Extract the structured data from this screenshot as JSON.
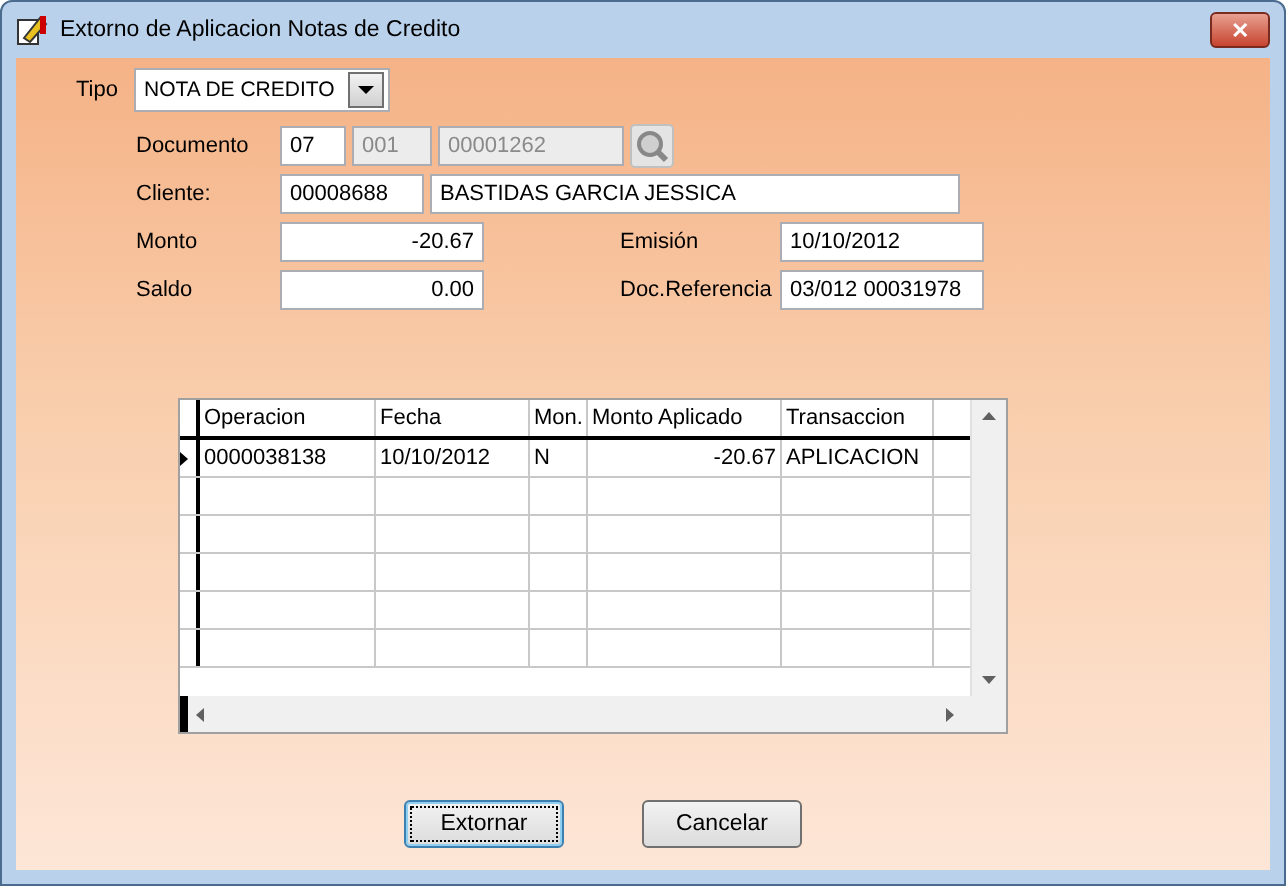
{
  "window": {
    "title": "Extorno de Aplicacion Notas de Credito",
    "close": "✕"
  },
  "tipo": {
    "label": "Tipo",
    "value": "NOTA DE CREDITO"
  },
  "documento": {
    "label": "Documento",
    "fields": [
      {
        "value": "07",
        "disabled": false
      },
      {
        "value": "001",
        "disabled": true
      },
      {
        "value": "00001262",
        "disabled": true
      }
    ]
  },
  "cliente": {
    "label": "Cliente:",
    "code": "00008688",
    "name": "BASTIDAS GARCIA JESSICA"
  },
  "monto": {
    "label": "Monto",
    "value": "-20.67"
  },
  "emision": {
    "label": "Emisión",
    "value": "10/10/2012"
  },
  "saldo": {
    "label": "Saldo",
    "value": "0.00"
  },
  "doc_referencia": {
    "label": "Doc.Referencia",
    "value": "03/012 00031978"
  },
  "table": {
    "columns": [
      "Operacion",
      "Fecha",
      "Mon.",
      "Monto Aplicado",
      "Transaccion"
    ],
    "rows": [
      {
        "selected": true,
        "cells": [
          "0000038138",
          "10/10/2012",
          "N",
          "-20.67",
          "APLICACION"
        ]
      }
    ]
  },
  "buttons": [
    {
      "label": "Extornar",
      "focused": true
    },
    {
      "label": "Cancelar",
      "focused": false
    }
  ]
}
